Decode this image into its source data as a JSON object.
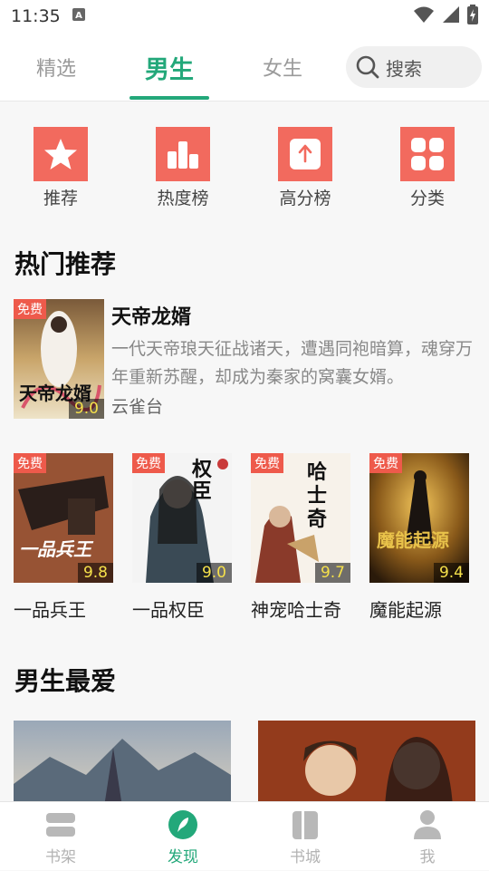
{
  "status": {
    "time": "11:35"
  },
  "tabs": [
    {
      "label": "精选"
    },
    {
      "label": "男生"
    },
    {
      "label": "女生"
    }
  ],
  "search": {
    "placeholder": "搜索"
  },
  "categories": [
    {
      "label": "推荐",
      "icon": "star-icon"
    },
    {
      "label": "热度榜",
      "icon": "bar-chart-icon"
    },
    {
      "label": "高分榜",
      "icon": "arrow-up-icon"
    },
    {
      "label": "分类",
      "icon": "grid-icon"
    }
  ],
  "hot": {
    "title": "热门推荐",
    "featured": {
      "badge": "免费",
      "score": "9.0",
      "name": "天帝龙婿",
      "desc": "一代天帝琅天征战诸天，遭遇同袍暗算，魂穿万年重新苏醒，却成为秦家的窝囊女婿。",
      "author": "云雀台",
      "cover_text": "天帝龙婿"
    },
    "books": [
      {
        "badge": "免费",
        "score": "9.8",
        "name": "一品兵王",
        "cover_text": "一品兵王"
      },
      {
        "badge": "免费",
        "score": "9.0",
        "name": "一品权臣",
        "cover_text": "权臣"
      },
      {
        "badge": "免费",
        "score": "9.7",
        "name": "神宠哈士奇",
        "cover_text": "哈士奇"
      },
      {
        "badge": "免费",
        "score": "9.4",
        "name": "魔能起源",
        "cover_text": "魔能起源"
      }
    ]
  },
  "fav": {
    "title": "男生最爱"
  },
  "bottom_nav": [
    {
      "label": "书架",
      "icon": "bookshelf-icon"
    },
    {
      "label": "发现",
      "icon": "compass-icon"
    },
    {
      "label": "书城",
      "icon": "book-icon"
    },
    {
      "label": "我",
      "icon": "person-icon"
    }
  ],
  "colors": {
    "accent": "#23a87a",
    "category_icon_bg": "#f26a5e",
    "badge": "#ee5a4b",
    "score_text": "#f5e04b"
  }
}
